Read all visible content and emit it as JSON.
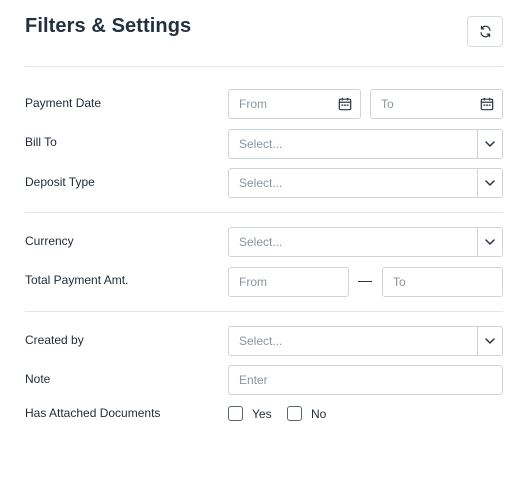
{
  "header": {
    "title": "Filters & Settings",
    "refresh_icon": "refresh-icon"
  },
  "filters": {
    "payment_date": {
      "label": "Payment Date",
      "from_placeholder": "From",
      "to_placeholder": "To"
    },
    "bill_to": {
      "label": "Bill To",
      "placeholder": "Select..."
    },
    "deposit_type": {
      "label": "Deposit Type",
      "placeholder": "Select..."
    },
    "currency": {
      "label": "Currency",
      "placeholder": "Select..."
    },
    "total_payment_amt": {
      "label": "Total Payment Amt.",
      "from_placeholder": "From",
      "to_placeholder": "To"
    },
    "created_by": {
      "label": "Created by",
      "placeholder": "Select..."
    },
    "note": {
      "label": "Note",
      "placeholder": "Enter"
    },
    "has_attached_documents": {
      "label": "Has Attached Documents",
      "yes_label": "Yes",
      "no_label": "No"
    }
  },
  "colors": {
    "border": "#ced4da",
    "placeholder": "#8a949e",
    "text": "#1f2a37"
  }
}
